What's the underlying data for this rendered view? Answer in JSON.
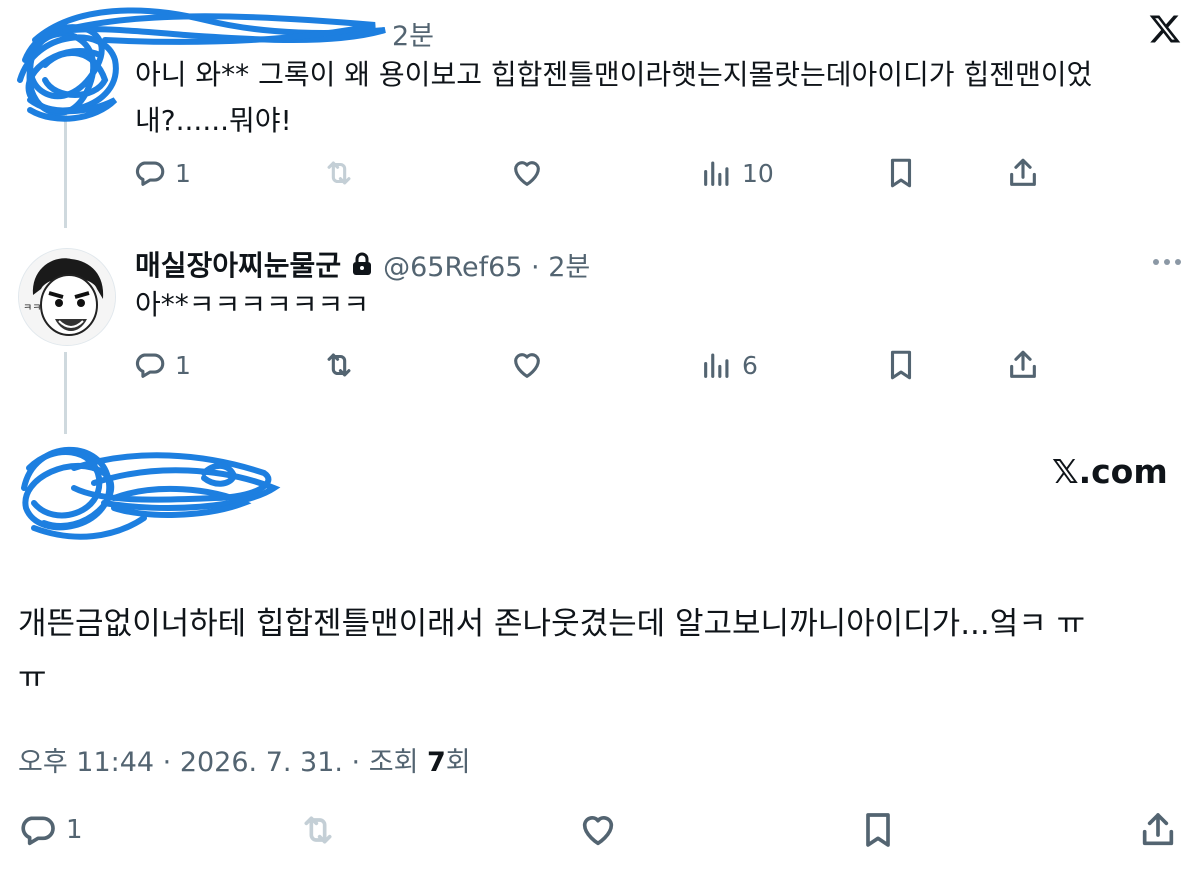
{
  "tweet1": {
    "time": "2분",
    "text_line1": "아니 와** 그록이 왜 용이보고 힙합젠틀맨이라햇는지몰랏는데아이디가 힙젠맨이었",
    "text_line2": "내?......뭐야!",
    "reply_count": "1",
    "view_count": "10"
  },
  "tweet2": {
    "display_name": "매실장아찌눈물군",
    "handle_time": "@65Ref65 · 2분",
    "text": "아**ㅋㅋㅋㅋㅋㅋㅋ",
    "reply_count": "1",
    "view_count": "6"
  },
  "main_tweet": {
    "source": "𝕏.com",
    "text_line1": "개뜬금없이너하테 힙합젠틀맨이래서 존나웃겼는데 알고보니까니아이디가...엌ㅋ ㅠ",
    "text_line2": "ㅠ",
    "time_date": "오후 11:44 · 2026. 7. 31. · 조회 ",
    "views": "7",
    "views_suffix": "회",
    "reply_count": "1"
  },
  "colors": {
    "redaction": "#1d7fe0",
    "muted": "#536471",
    "text": "#0f1419"
  }
}
